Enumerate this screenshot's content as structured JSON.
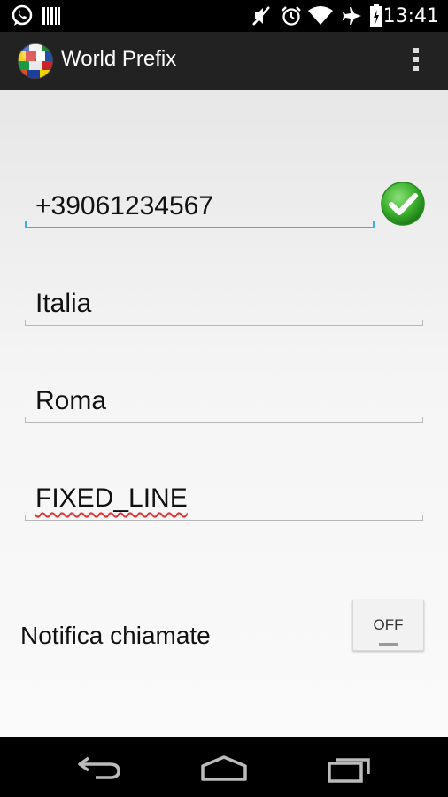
{
  "status_bar": {
    "time": "13:41",
    "icons": [
      "whatsapp-icon",
      "barcode-icon",
      "mute-icon",
      "alarm-icon",
      "wifi-icon",
      "airplane-icon",
      "battery-icon"
    ]
  },
  "action_bar": {
    "title": "World Prefix",
    "overflow_icon": "overflow-menu-icon"
  },
  "form": {
    "phone_number": "+39061234567",
    "country": "Italia",
    "city": "Roma",
    "line_type": "FIXED_LINE",
    "valid_icon": "check-icon"
  },
  "notification": {
    "label": "Notifica chiamate",
    "toggle_state": "OFF"
  },
  "nav_bar": {
    "icons": [
      "back-icon",
      "home-icon",
      "recents-icon"
    ]
  },
  "colors": {
    "accent": "#33b5e5",
    "action_bar": "#222222",
    "check_green": "#3cb22e"
  }
}
